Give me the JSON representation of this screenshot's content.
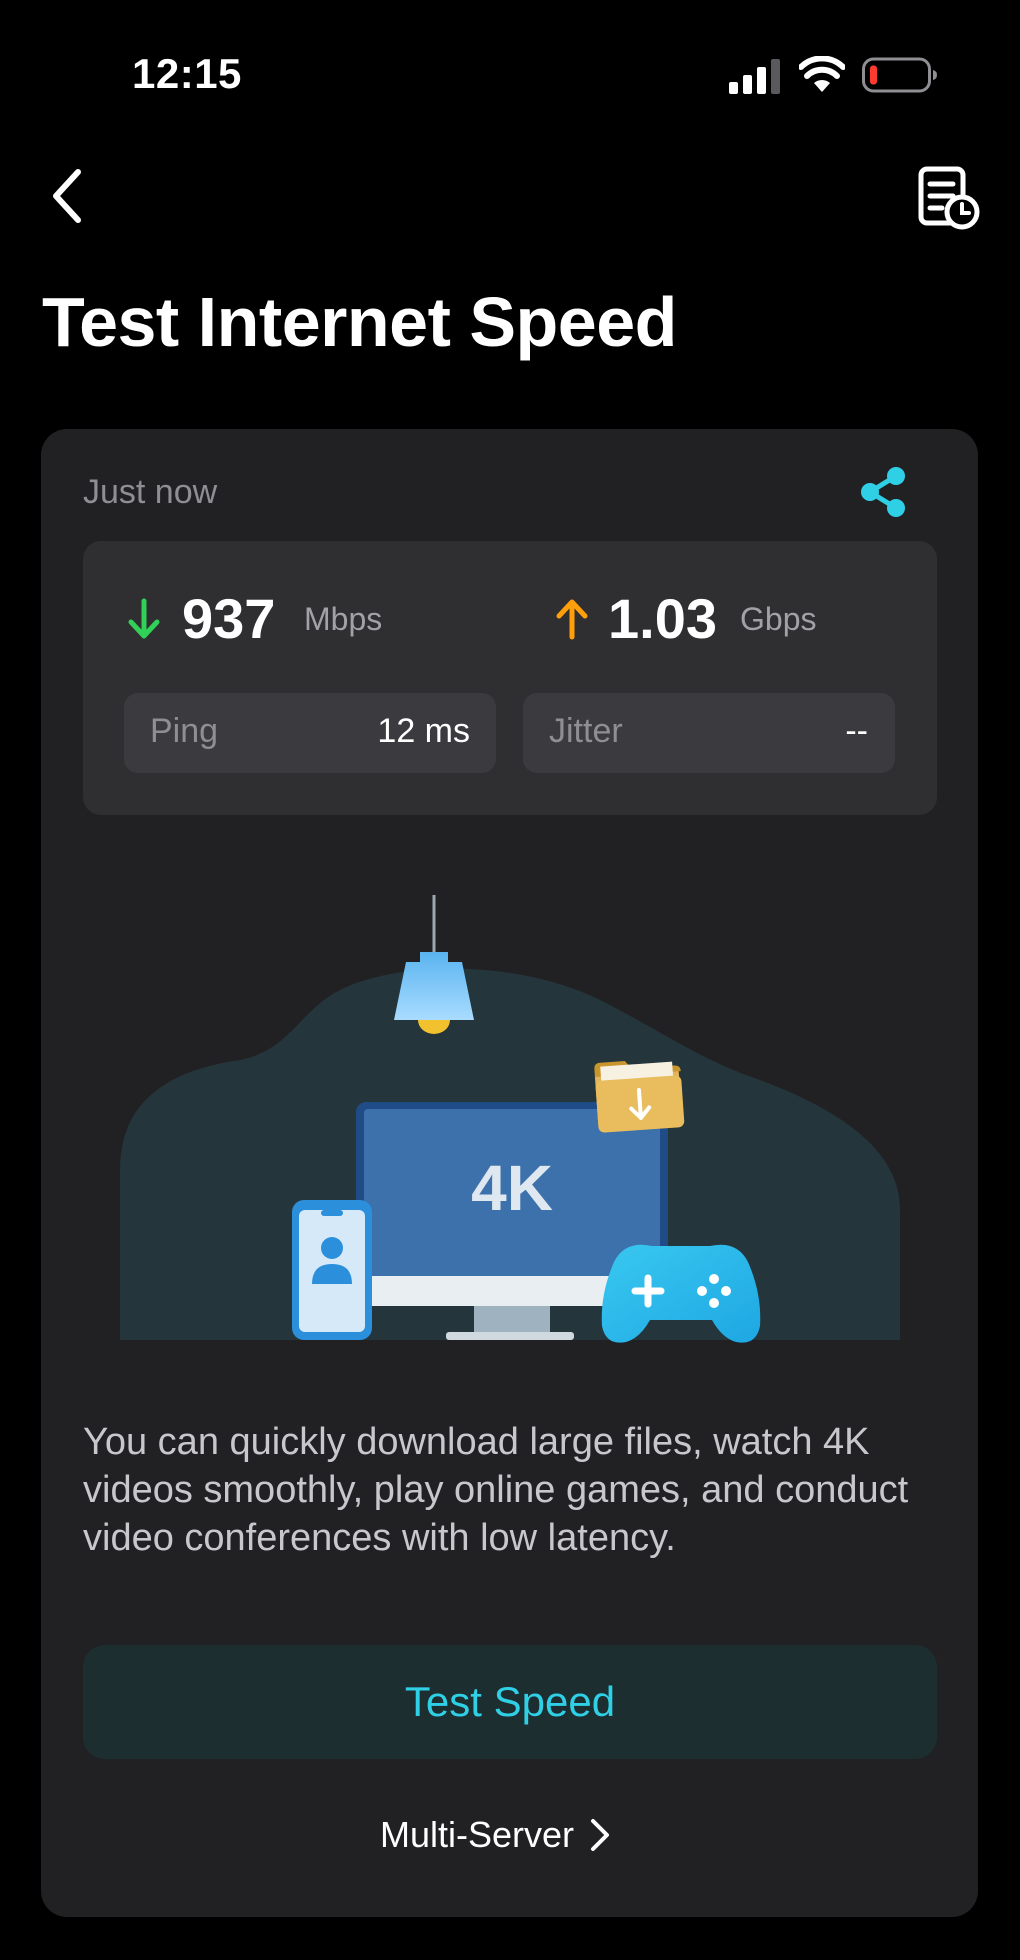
{
  "status_bar": {
    "time": "12:15",
    "battery_color": "#ff3b30"
  },
  "nav": {
    "back_icon": "chevron-left-icon",
    "history_icon": "document-clock-icon"
  },
  "page": {
    "title": "Test Internet Speed"
  },
  "result": {
    "timestamp": "Just now",
    "share_icon": "share-icon",
    "download": {
      "value": "937",
      "unit": "Mbps",
      "color": "#31d158"
    },
    "upload": {
      "value": "1.03",
      "unit": "Gbps",
      "color": "#ff9f0a"
    },
    "ping": {
      "label": "Ping",
      "value": "12 ms"
    },
    "jitter": {
      "label": "Jitter",
      "value": "--"
    }
  },
  "illustration": {
    "monitor_text": "4K"
  },
  "description": "You can quickly download large files, watch 4K videos smoothly, play online games, and conduct video conferences with low latency.",
  "actions": {
    "test_speed": "Test Speed",
    "multi_server": "Multi-Server"
  },
  "colors": {
    "accent": "#2fd0e6",
    "background": "#000000",
    "card": "#212123"
  }
}
